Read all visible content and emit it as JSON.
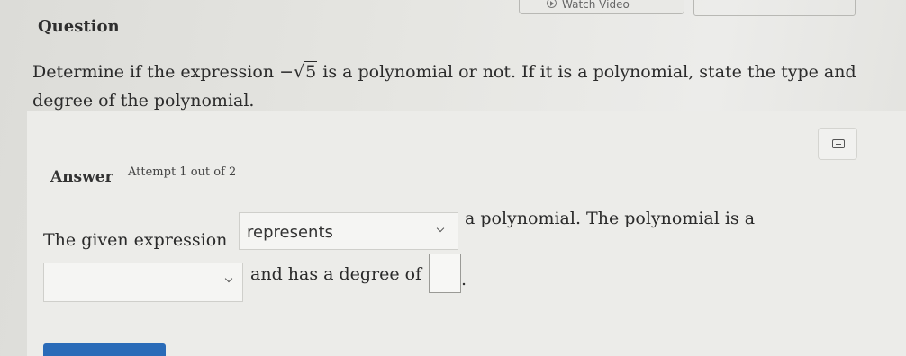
{
  "header": {
    "watch_video_label": "Watch Video"
  },
  "question": {
    "heading": "Question",
    "text_before": "Determine if the expression ",
    "minus": "−",
    "sqrt_symbol": "√",
    "radicand": "5",
    "text_after": " is a polynomial or not. If it is a polynomial, state the type and degree of the polynomial."
  },
  "answer": {
    "heading": "Answer",
    "attempt": "Attempt 1 out of 2",
    "sentence1_start": "The given expression",
    "select1_value": "represents",
    "sentence1_end": "a polynomial. The polynomial is a",
    "select2_value": "",
    "sentence2_mid": "and has a degree of",
    "degree_value": "",
    "period": "."
  },
  "icons": {
    "play": "play-circle-icon",
    "keyboard": "keyboard-icon",
    "dropdown": "chevron-down-icon"
  },
  "colors": {
    "submit_button": "#2a6bb8"
  }
}
